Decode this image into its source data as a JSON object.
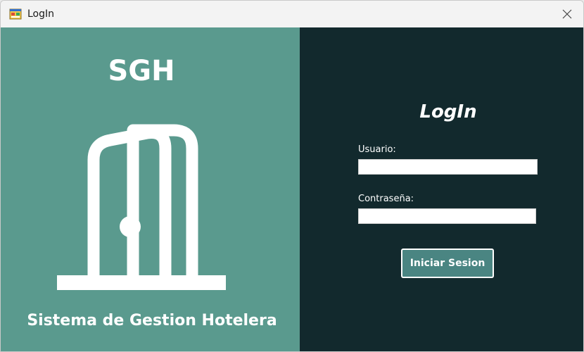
{
  "window": {
    "title": "LogIn",
    "icons": {
      "app": "form-app-icon",
      "close": "close-icon"
    }
  },
  "brand": {
    "title": "SGH",
    "subtitle": "Sistema de Gestion Hotelera",
    "icon": "door-icon",
    "panel_color": "#5a9a8e"
  },
  "login": {
    "heading": "LogIn",
    "panel_color": "#12292d",
    "username": {
      "label": "Usuario:",
      "value": "",
      "placeholder": ""
    },
    "password": {
      "label": "Contraseña:",
      "value": "",
      "placeholder": ""
    },
    "submit_label": "Iniciar Sesion",
    "button_color": "#4a8582"
  }
}
